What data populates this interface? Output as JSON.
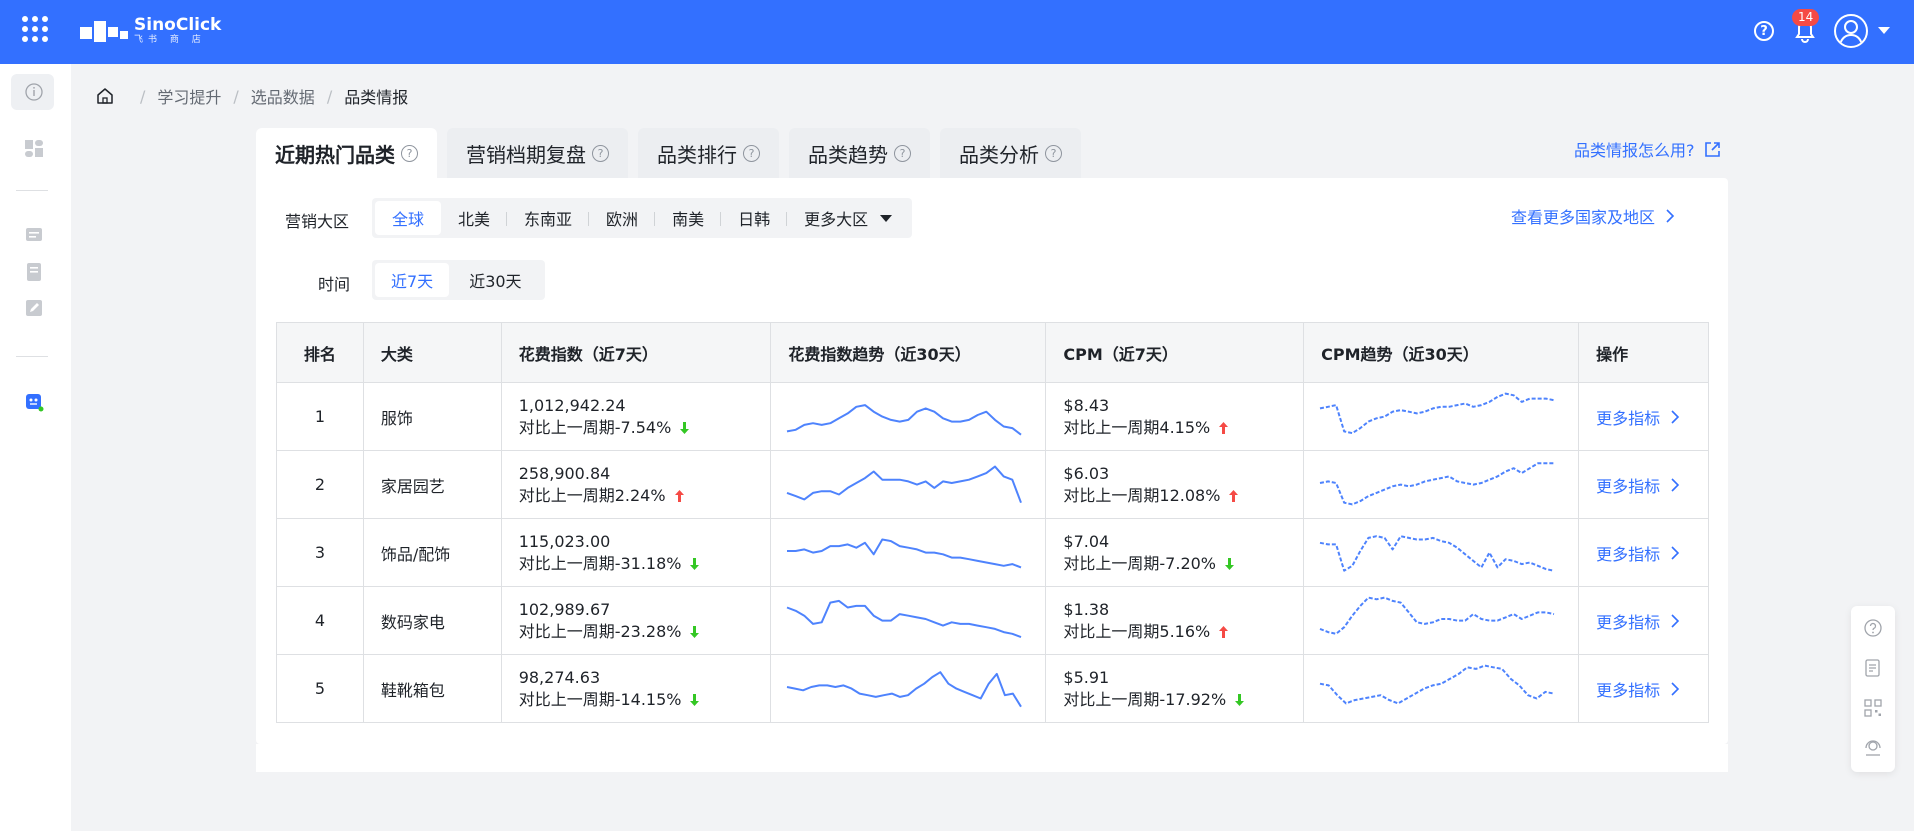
{
  "app": {
    "name": "SinoClick",
    "subtitle": "飞书 商 店"
  },
  "header": {
    "notification_count": "14"
  },
  "breadcrumb": [
    "学习提升",
    "选品数据",
    "品类情报"
  ],
  "tabs": [
    {
      "label": "近期热门品类",
      "active": true
    },
    {
      "label": "营销档期复盘"
    },
    {
      "label": "品类排行"
    },
    {
      "label": "品类趋势"
    },
    {
      "label": "品类分析"
    }
  ],
  "howto_link": "品类情报怎么用?",
  "filters": {
    "region_label": "营销大区",
    "regions": [
      "全球",
      "北美",
      "东南亚",
      "欧洲",
      "南美",
      "日韩"
    ],
    "regions_more": "更多大区",
    "region_selected": "全球",
    "more_countries": "查看更多国家及地区",
    "time_label": "时间",
    "times": [
      "近7天",
      "近30天"
    ],
    "time_selected": "近7天"
  },
  "table": {
    "columns": [
      "排名",
      "大类",
      "花费指数（近7天）",
      "花费指数趋势（近30天）",
      "CPM（近7天）",
      "CPM趋势（近30天）",
      "操作"
    ],
    "rows": [
      {
        "rank": "1",
        "category": "服饰",
        "spend": "1,012,942.24",
        "spend_change": "对比上一周期-7.54%",
        "spend_dir": "down",
        "cpm": "$8.43",
        "cpm_change": "对比上一周期4.15%",
        "cpm_dir": "up",
        "action": "更多指标",
        "spend_trend": [
          4,
          5,
          8,
          9,
          8,
          9,
          12,
          15,
          19,
          20,
          16,
          13,
          11,
          10,
          11,
          16,
          18,
          16,
          12,
          10,
          10,
          11,
          14,
          16,
          11,
          7,
          6,
          2
        ],
        "cpm_trend": [
          18,
          19,
          20,
          4,
          3,
          6,
          10,
          12,
          13,
          16,
          17,
          16,
          15,
          16,
          18,
          19,
          19,
          20,
          21,
          19,
          20,
          22,
          25,
          27,
          26,
          22,
          24,
          24,
          24,
          23
        ]
      },
      {
        "rank": "2",
        "category": "家居园艺",
        "spend": "258,900.84",
        "spend_change": "对比上一周期2.24%",
        "spend_dir": "up",
        "cpm": "$6.03",
        "cpm_change": "对比上一周期12.08%",
        "cpm_dir": "up",
        "action": "更多指标",
        "spend_trend": [
          8,
          6,
          4,
          8,
          9,
          9,
          7,
          11,
          14,
          17,
          21,
          16,
          16,
          16,
          15,
          13,
          15,
          11,
          15,
          14,
          15,
          16,
          18,
          20,
          24,
          18,
          16,
          2
        ],
        "cpm_trend": [
          14,
          15,
          14,
          2,
          1,
          3,
          6,
          8,
          10,
          12,
          13,
          12,
          13,
          15,
          16,
          17,
          18,
          15,
          14,
          13,
          14,
          16,
          18,
          21,
          23,
          20,
          23,
          26,
          26,
          26
        ]
      },
      {
        "rank": "3",
        "category": "饰品/配饰",
        "spend": "115,023.00",
        "spend_change": "对比上一周期-31.18%",
        "spend_dir": "down",
        "cpm": "$7.04",
        "cpm_change": "对比上一周期-7.20%",
        "cpm_dir": "down",
        "action": "更多指标",
        "spend_trend": [
          14,
          14,
          15,
          13,
          14,
          17,
          17,
          18,
          16,
          19,
          12,
          21,
          20,
          17,
          16,
          15,
          13,
          13,
          12,
          10,
          10,
          9,
          8,
          7,
          6,
          5,
          6,
          4
        ],
        "cpm_trend": [
          19,
          18,
          18,
          2,
          5,
          14,
          22,
          23,
          22,
          15,
          23,
          22,
          21,
          21,
          22,
          20,
          19,
          16,
          12,
          8,
          4,
          13,
          4,
          9,
          8,
          6,
          7,
          5,
          3,
          2
        ]
      },
      {
        "rank": "4",
        "category": "数码家电",
        "spend": "102,989.67",
        "spend_change": "对比上一周期-23.28%",
        "spend_dir": "down",
        "cpm": "$1.38",
        "cpm_change": "对比上一周期5.16%",
        "cpm_dir": "up",
        "action": "更多指标",
        "spend_trend": [
          21,
          19,
          16,
          11,
          12,
          24,
          25,
          21,
          22,
          22,
          16,
          13,
          13,
          17,
          16,
          15,
          14,
          12,
          10,
          12,
          11,
          11,
          10,
          9,
          8,
          6,
          5,
          3
        ],
        "cpm_trend": [
          8,
          6,
          5,
          9,
          16,
          22,
          27,
          26,
          27,
          25,
          24,
          18,
          12,
          11,
          12,
          14,
          14,
          13,
          13,
          17,
          14,
          13,
          13,
          15,
          17,
          14,
          16,
          18,
          18,
          17
        ]
      },
      {
        "rank": "5",
        "category": "鞋靴箱包",
        "spend": "98,274.63",
        "spend_change": "对比上一周期-14.15%",
        "spend_dir": "down",
        "cpm": "$5.91",
        "cpm_change": "对比上一周期-17.92%",
        "cpm_dir": "down",
        "action": "更多指标",
        "spend_trend": [
          14,
          13,
          12,
          14,
          15,
          15,
          14,
          15,
          13,
          10,
          9,
          8,
          9,
          10,
          8,
          9,
          13,
          16,
          20,
          23,
          16,
          13,
          11,
          9,
          7,
          16,
          22,
          9,
          10,
          2
        ],
        "cpm_trend": [
          16,
          15,
          9,
          4,
          6,
          7,
          8,
          9,
          6,
          4,
          7,
          10,
          13,
          15,
          16,
          19,
          22,
          26,
          25,
          27,
          26,
          25,
          19,
          15,
          9,
          7,
          11,
          10
        ]
      }
    ]
  },
  "colors": {
    "primary": "#3370ff",
    "up": "#f54a45",
    "down": "#34c724",
    "trend_line": "#4e83fd"
  }
}
